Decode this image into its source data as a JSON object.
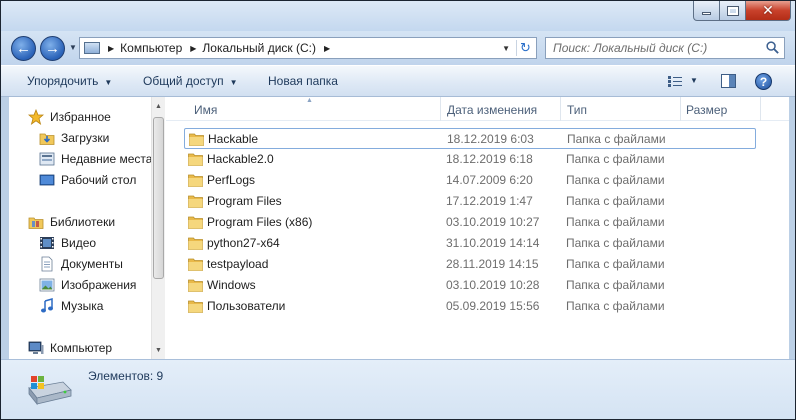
{
  "window": {
    "controls": {
      "minimize": "–",
      "maximize": "□",
      "close": "✕"
    }
  },
  "navigation": {
    "back_icon": "arrow-left-icon",
    "forward_icon": "arrow-right-icon",
    "breadcrumb": [
      "Компьютер",
      "Локальный диск (C:)"
    ],
    "refresh_icon": "refresh-icon"
  },
  "search": {
    "placeholder": "Поиск: Локальный диск (C:)"
  },
  "toolbar": {
    "organize_label": "Упорядочить",
    "share_label": "Общий доступ",
    "new_folder_label": "Новая папка",
    "help_label": "?"
  },
  "sidebar": {
    "favorites": {
      "label": "Избранное",
      "items": [
        {
          "label": "Загрузки",
          "icon": "downloads-icon"
        },
        {
          "label": "Недавние места",
          "icon": "recent-places-icon"
        },
        {
          "label": "Рабочий стол",
          "icon": "desktop-icon"
        }
      ]
    },
    "libraries": {
      "label": "Библиотеки",
      "items": [
        {
          "label": "Видео",
          "icon": "video-icon"
        },
        {
          "label": "Документы",
          "icon": "documents-icon"
        },
        {
          "label": "Изображения",
          "icon": "pictures-icon"
        },
        {
          "label": "Музыка",
          "icon": "music-icon"
        }
      ]
    },
    "computer": {
      "label": "Компьютер"
    }
  },
  "columns": {
    "name": "Имя",
    "date": "Дата изменения",
    "type": "Тип",
    "size": "Размер"
  },
  "files": [
    {
      "name": "Hackable",
      "date": "18.12.2019 6:03",
      "type": "Папка с файлами"
    },
    {
      "name": "Hackable2.0",
      "date": "18.12.2019 6:18",
      "type": "Папка с файлами"
    },
    {
      "name": "PerfLogs",
      "date": "14.07.2009 6:20",
      "type": "Папка с файлами"
    },
    {
      "name": "Program Files",
      "date": "17.12.2019 1:47",
      "type": "Папка с файлами"
    },
    {
      "name": "Program Files (x86)",
      "date": "03.10.2019 10:27",
      "type": "Папка с файлами"
    },
    {
      "name": "python27-x64",
      "date": "31.10.2019 14:14",
      "type": "Папка с файлами"
    },
    {
      "name": "testpayload",
      "date": "28.11.2019 14:15",
      "type": "Папка с файлами"
    },
    {
      "name": "Windows",
      "date": "03.10.2019 10:28",
      "type": "Папка с файлами"
    },
    {
      "name": "Пользователи",
      "date": "05.09.2019 15:56",
      "type": "Папка с файлами"
    }
  ],
  "status": {
    "item_count": "Элементов: 9"
  }
}
